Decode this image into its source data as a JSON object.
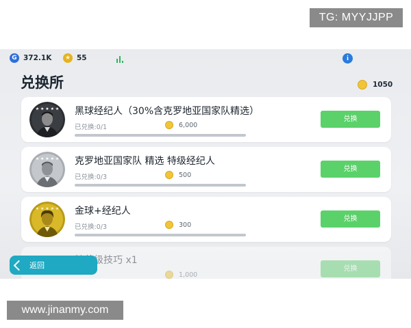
{
  "watermarks": {
    "top": "TG: MYYJJPP",
    "bottom": "www.jinanmy.com"
  },
  "topbar": {
    "gp": {
      "icon": "G",
      "value": "372.1K"
    },
    "coins": {
      "icon": "★",
      "value": "55"
    },
    "info_icon": "i"
  },
  "title": "兑换所",
  "balance": "1050",
  "cards": [
    {
      "name": "黑球经纪人（30%含克罗地亚国家队精选）",
      "count": "已兑换:0/1",
      "price": "6,000",
      "button": "兑换",
      "avatar_tone": "black",
      "progress": 0
    },
    {
      "name": "克罗地亚国家队 精选 特级经纪人",
      "count": "已兑换:0/3",
      "price": "500",
      "button": "兑换",
      "avatar_tone": "silver",
      "progress": 0
    },
    {
      "name": "金球+经纪人",
      "count": "已兑换:0/3",
      "price": "300",
      "button": "兑换",
      "avatar_tone": "gold",
      "progress": 0
    },
    {
      "name": "精英级技巧 x1",
      "count": "",
      "price": "1,000",
      "button": "兑换",
      "avatar_tone": "none",
      "progress": 0
    }
  ],
  "back_button": {
    "label": "返回"
  },
  "colors": {
    "accent_green": "#5bd16a",
    "back_teal": "#1fa9c2",
    "coin_gold": "#f0c53a"
  }
}
